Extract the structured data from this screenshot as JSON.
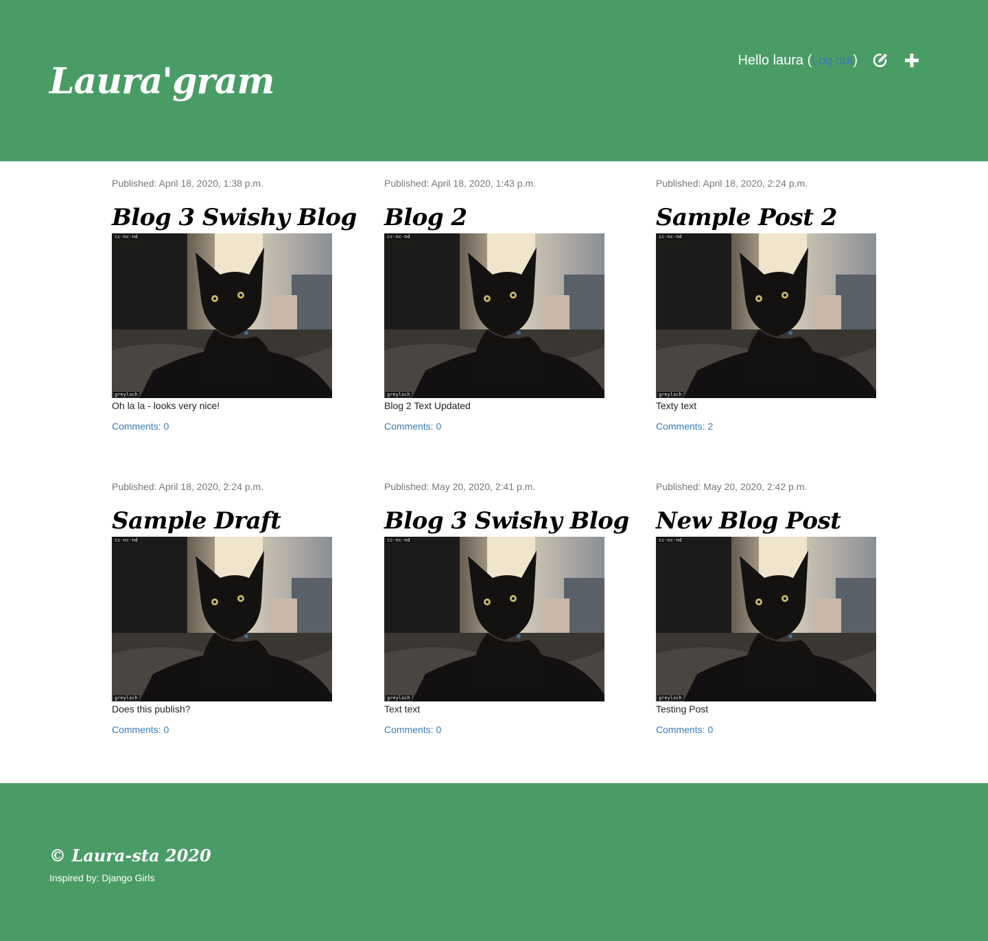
{
  "header": {
    "brand": "Laura'gram",
    "greeting": "Hello laura (",
    "logout_label": "Log out",
    "greeting_close": ")",
    "edit_icon": "edit-icon",
    "add_icon": "plus-icon"
  },
  "photo": {
    "watermark_top": "cc-nc-nd",
    "watermark_bottom": "greyloch"
  },
  "posts": [
    {
      "published": "Published: April 18, 2020, 1:38 p.m.",
      "title": "Blog 3 Swishy Blog",
      "text": "Oh la la - looks very nice!",
      "comments": "Comments: 0"
    },
    {
      "published": "Published: April 18, 2020, 1:43 p.m.",
      "title": "Blog 2",
      "text": "Blog 2 Text Updated",
      "comments": "Comments: 0"
    },
    {
      "published": "Published: April 18, 2020, 2:24 p.m.",
      "title": "Sample Post 2",
      "text": "Texty text",
      "comments": "Comments: 2"
    },
    {
      "published": "Published: April 18, 2020, 2:24 p.m.",
      "title": "Sample Draft",
      "text": "Does this publish?",
      "comments": "Comments: 0"
    },
    {
      "published": "Published: May 20, 2020, 2:41 p.m.",
      "title": "Blog 3 Swishy Blog",
      "text": "Text text",
      "comments": "Comments: 0"
    },
    {
      "published": "Published: May 20, 2020, 2:42 p.m.",
      "title": "New Blog Post",
      "text": "Testing Post",
      "comments": "Comments: 0"
    }
  ],
  "footer": {
    "copyright": "© Laura-sta 2020",
    "inspired": "Inspired by: Django Girls"
  },
  "colors": {
    "brand_green": "#4a9c66",
    "link_blue": "#3a7bb5"
  }
}
